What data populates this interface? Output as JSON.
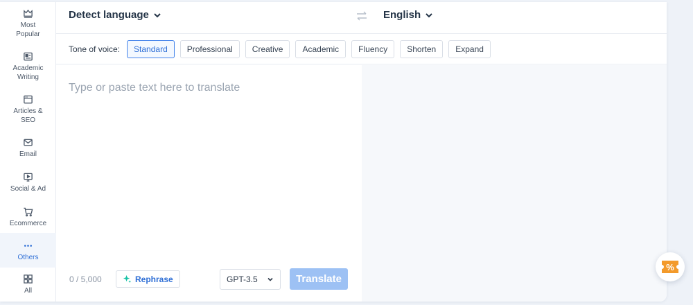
{
  "sidebar": {
    "items": [
      {
        "label": "Most\nPopular",
        "icon": "crown-icon",
        "active": false
      },
      {
        "label": "Academic\nWriting",
        "icon": "academic-card-icon",
        "active": false
      },
      {
        "label": "Articles &\nSEO",
        "icon": "browser-window-icon",
        "active": false
      },
      {
        "label": "Email",
        "icon": "envelope-icon",
        "active": false
      },
      {
        "label": "Social & Ad",
        "icon": "monitor-play-icon",
        "active": false
      },
      {
        "label": "Ecommerce",
        "icon": "cart-icon",
        "active": false
      },
      {
        "label": "Others",
        "icon": "dots-icon",
        "active": true
      },
      {
        "label": "All",
        "icon": "grid-icon",
        "active": false
      }
    ]
  },
  "header": {
    "source_language": "Detect language",
    "target_language": "English"
  },
  "tone": {
    "label": "Tone of voice:",
    "options": [
      "Standard",
      "Professional",
      "Creative",
      "Academic",
      "Fluency",
      "Shorten",
      "Expand"
    ],
    "selected": "Standard"
  },
  "editor": {
    "placeholder": "Type or paste text here to translate",
    "value": ""
  },
  "footer": {
    "counter": "0 / 5,000",
    "rephrase_label": "Rephrase",
    "model": "GPT-3.5",
    "translate_label": "Translate"
  },
  "colors": {
    "accent": "#2f6fd6",
    "translate_disabled": "#9dc1f4",
    "rephrase_sparkle": "#18c2a6",
    "promo": "#f39a2b"
  },
  "promo": {
    "icon": "percent-ticket-icon",
    "text": "%"
  }
}
